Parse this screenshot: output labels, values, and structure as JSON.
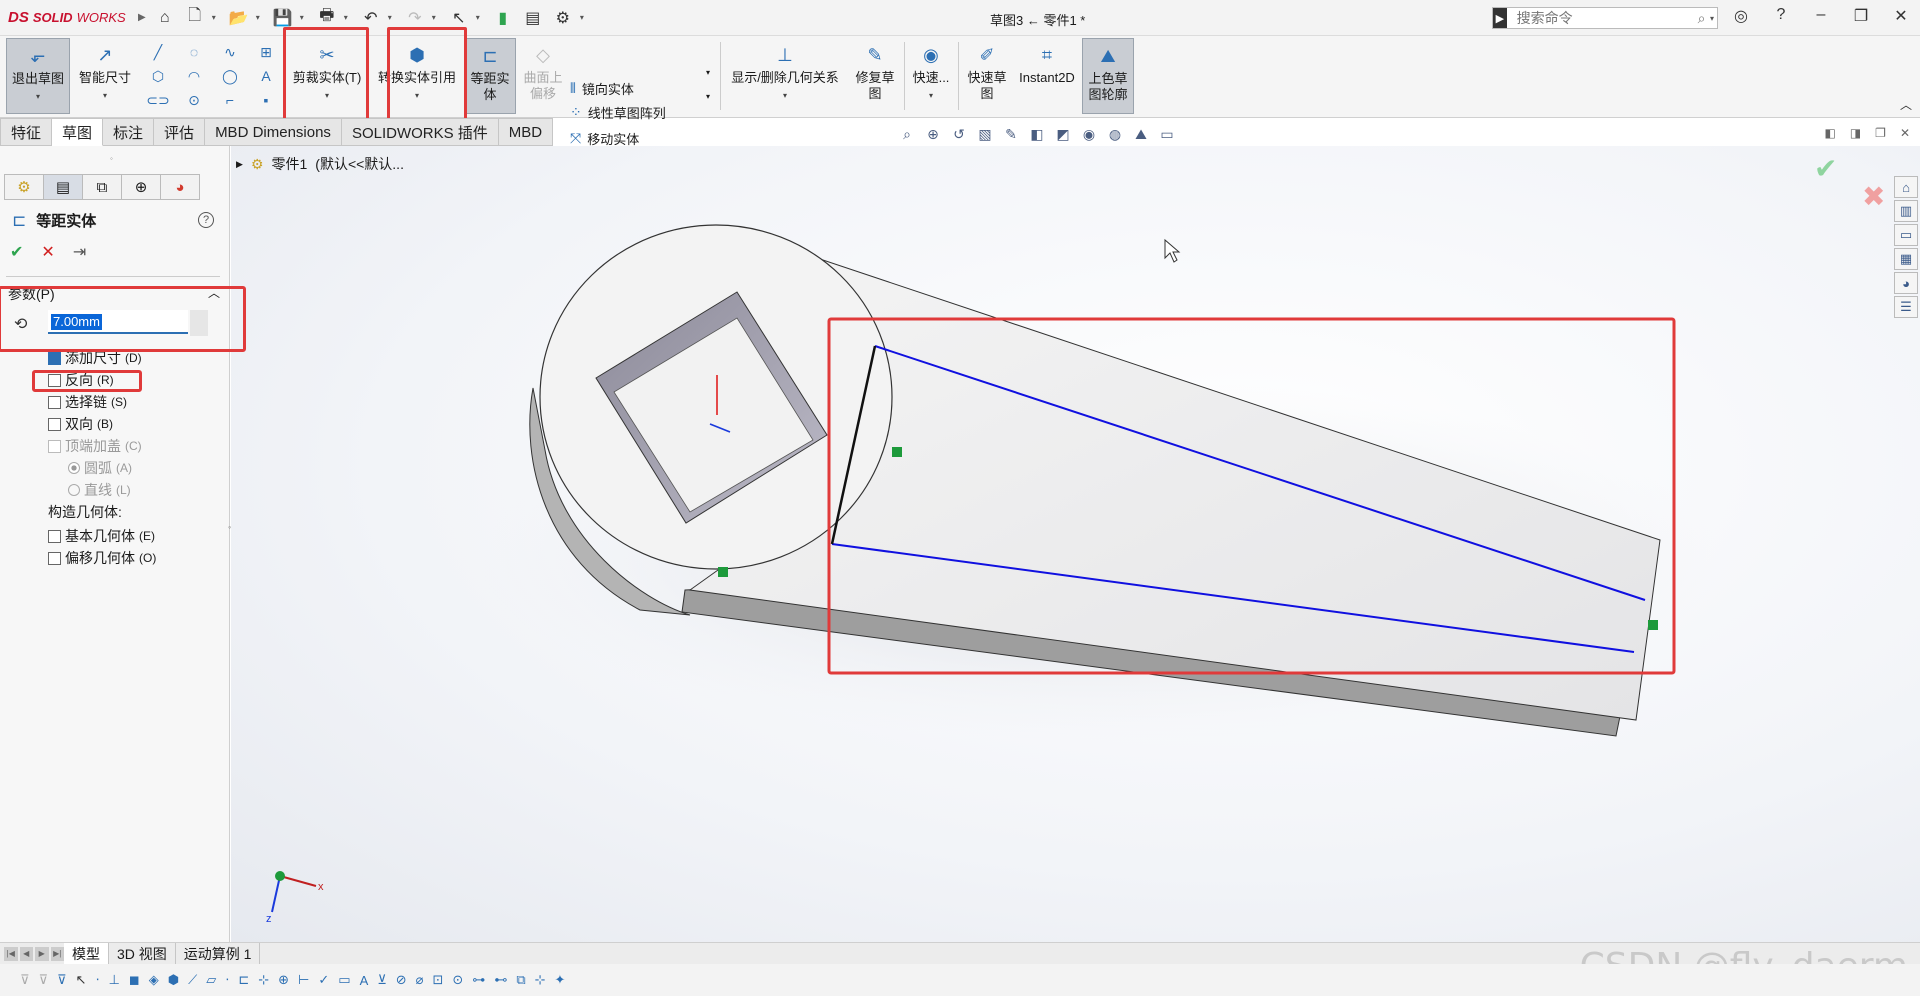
{
  "app": {
    "logo_ds": "DS",
    "logo_name": "SOLID",
    "logo_name2": "WORKS"
  },
  "title": "草图3 ← 零件1 *",
  "search": {
    "placeholder": "搜索命令"
  },
  "command_manager": {
    "exit_sketch": "退出草图",
    "smart_dimension": "智能尺寸",
    "trim_entities": "剪裁实体(T)",
    "convert_entities": "转换实体引用",
    "offset_entities": "等距实体",
    "offset_on_surface": "曲面上偏移",
    "mirror_entities": "镜向实体",
    "linear_pattern": "线性草图阵列",
    "move_entities": "移动实体",
    "display_relations": "显示/删除几何关系",
    "repair_sketch": "修复草图",
    "quick_snaps": "快速...",
    "rapid_sketch": "快速草图",
    "instant2d": "Instant2D",
    "shaded_contours": "上色草图轮廓"
  },
  "tabs": [
    "特征",
    "草图",
    "标注",
    "评估",
    "MBD Dimensions",
    "SOLIDWORKS 插件",
    "MBD"
  ],
  "active_tab": "草图",
  "tree": {
    "part": "零件1",
    "config": "(默认<<默认..."
  },
  "property_manager": {
    "title": "等距实体",
    "help": "?",
    "params_label": "参数(P)",
    "distance": "7.00mm",
    "options": [
      {
        "label": "添加尺寸",
        "shortcut": "(D)",
        "checked": true,
        "disabled": false
      },
      {
        "label": "反向",
        "shortcut": "(R)",
        "checked": false,
        "disabled": false
      },
      {
        "label": "选择链",
        "shortcut": "(S)",
        "checked": false,
        "disabled": false
      },
      {
        "label": "双向",
        "shortcut": "(B)",
        "checked": false,
        "disabled": false
      },
      {
        "label": "顶端加盖",
        "shortcut": "(C)",
        "checked": false,
        "disabled": true
      }
    ],
    "cap_options": [
      {
        "label": "圆弧",
        "shortcut": "(A)",
        "selected": true
      },
      {
        "label": "直线",
        "shortcut": "(L)",
        "selected": false
      }
    ],
    "construction_label": "构造几何体:",
    "construction_options": [
      {
        "label": "基本几何体",
        "shortcut": "(E)"
      },
      {
        "label": "偏移几何体",
        "shortcut": "(O)"
      }
    ]
  },
  "bottom_tabs": [
    "模型",
    "3D 视图",
    "运动算例 1"
  ],
  "active_bottom_tab": "模型",
  "watermark": "CSDN @fly_daerm",
  "colors": {
    "accent": "#2c6fb3",
    "highlight": "#e03a3a",
    "sketch_line": "#1010e0"
  }
}
